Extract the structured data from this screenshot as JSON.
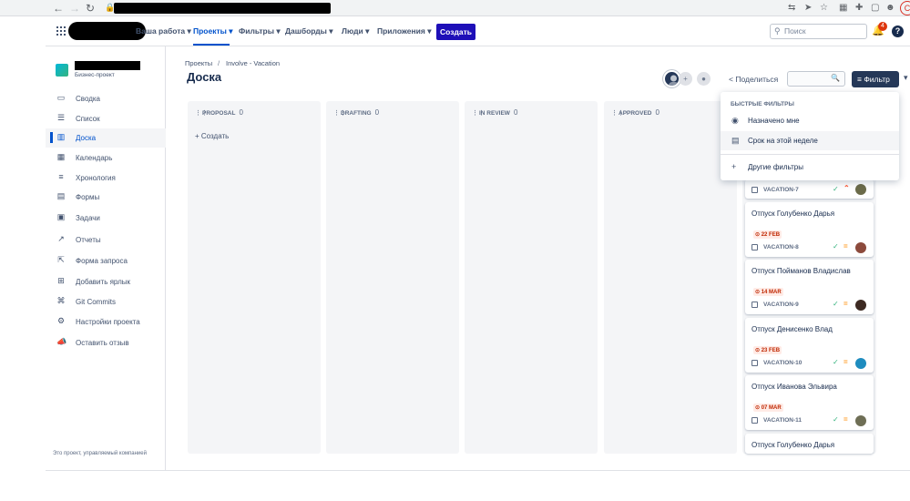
{
  "browser": {
    "back": "←",
    "forward": "→",
    "reload": "↻",
    "lock": "🔒",
    "ext_icons": [
      "⇆",
      "➤",
      "☆",
      "▦",
      "✚",
      "▢",
      "☻"
    ],
    "profile": "C"
  },
  "topnav": {
    "menus": [
      {
        "label": "Ваша работа ▾"
      },
      {
        "label": "Проекты ▾"
      },
      {
        "label": "Фильтры ▾"
      },
      {
        "label": "Дашборды ▾"
      },
      {
        "label": "Люди ▾"
      },
      {
        "label": "Приложения ▾"
      }
    ],
    "create_label": "Создать",
    "search_placeholder": "Поиск",
    "notifications_count": "4",
    "help": "?"
  },
  "sidebar": {
    "project_type": "Бизнес-проект",
    "items": [
      {
        "label": "Сводка",
        "icon": "▭"
      },
      {
        "label": "Список",
        "icon": "☰"
      },
      {
        "label": "Доска",
        "icon": "▥"
      },
      {
        "label": "Календарь",
        "icon": "▦"
      },
      {
        "label": "Хронология",
        "icon": "≡"
      },
      {
        "label": "Формы",
        "icon": "▤"
      },
      {
        "label": "Задачи",
        "icon": "▣"
      },
      {
        "label": "Отчеты",
        "icon": "↗"
      },
      {
        "label": "Форма запроса",
        "icon": "⇱"
      },
      {
        "label": "Добавить ярлык",
        "icon": "⊞"
      },
      {
        "label": "Git Commits",
        "icon": "⌘"
      },
      {
        "label": "Настройки проекта",
        "icon": "⚙"
      },
      {
        "label": "Оставить отзыв",
        "icon": "📣"
      }
    ],
    "footer": "Это проект, управляемый компанией"
  },
  "breadcrumb": {
    "root": "Проекты",
    "sep": "/",
    "project": "Involve - Vacation"
  },
  "page_title": "Доска",
  "toolbar": {
    "add_people": "+",
    "group": "●",
    "share_label": "Поделиться",
    "share_icon": "<",
    "search_icon": "🔍",
    "filter_label": "≡ Фильтр",
    "more": "▾"
  },
  "columns": [
    {
      "name": "PROPOSAL",
      "count": "0",
      "create": "+ Создать"
    },
    {
      "name": "DRAFTING",
      "count": "0"
    },
    {
      "name": "IN REVIEW",
      "count": "0"
    },
    {
      "name": "APPROVED",
      "count": "0"
    }
  ],
  "quick_filters": {
    "heading": "БЫСТРЫЕ ФИЛЬТРЫ",
    "items": [
      {
        "label": "Назначено мне",
        "icon": "◉"
      },
      {
        "label": "Срок на этой неделе",
        "icon": "▤"
      },
      {
        "label": "Другие фильтры",
        "icon": "+"
      }
    ]
  },
  "cards": [
    {
      "key": "VACATION-7",
      "partial": true
    },
    {
      "title": "Отпуск Голубенко Дарья",
      "date": "⊙ 22 FEB",
      "key": "VACATION-8"
    },
    {
      "title": "Отпуск Пойманов Владислав",
      "date": "⊙ 14 MAR",
      "key": "VACATION-9"
    },
    {
      "title": "Отпуск Денисенко Влад",
      "date": "⊙ 23 FEB",
      "key": "VACATION-10"
    },
    {
      "title": "Отпуск Иванова Эльвира",
      "date": "⊙ 07 MAR",
      "key": "VACATION-11"
    },
    {
      "title": "Отпуск Голубенко Дарья",
      "partial": true
    }
  ],
  "colors": {
    "primary": "#0052cc",
    "create_button": "#1e0fb8",
    "filter_button": "#253858",
    "overdue": "#bf2600"
  }
}
